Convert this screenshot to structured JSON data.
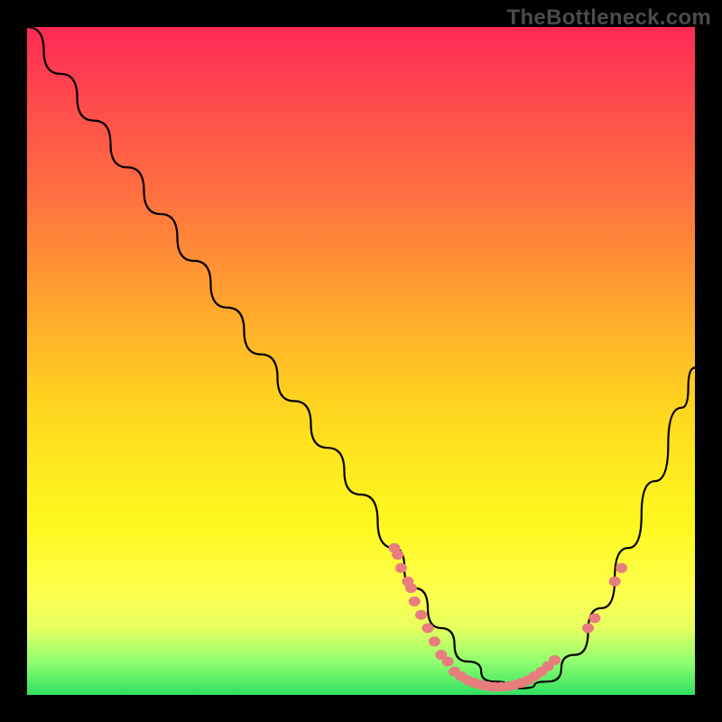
{
  "watermark": "TheBottleneck.com",
  "chart_data": {
    "type": "line",
    "title": "",
    "xlabel": "",
    "ylabel": "",
    "xlim": [
      0,
      100
    ],
    "ylim": [
      0,
      100
    ],
    "curve": {
      "x": [
        0,
        5,
        10,
        15,
        20,
        25,
        30,
        35,
        40,
        45,
        50,
        55,
        58,
        62,
        66,
        70,
        74,
        78,
        82,
        86,
        90,
        94,
        98,
        100
      ],
      "y": [
        100,
        93,
        86,
        79,
        72,
        65,
        58,
        51,
        44,
        37,
        30,
        22,
        16,
        10,
        5,
        2,
        1,
        2,
        6,
        13,
        22,
        32,
        43,
        49
      ]
    },
    "points": [
      {
        "x": 55,
        "y": 22
      },
      {
        "x": 55.5,
        "y": 21
      },
      {
        "x": 56,
        "y": 19
      },
      {
        "x": 57,
        "y": 17
      },
      {
        "x": 57.5,
        "y": 16
      },
      {
        "x": 58,
        "y": 14
      },
      {
        "x": 59,
        "y": 12
      },
      {
        "x": 60,
        "y": 10
      },
      {
        "x": 61,
        "y": 8
      },
      {
        "x": 62,
        "y": 6
      },
      {
        "x": 63,
        "y": 5
      },
      {
        "x": 64,
        "y": 3.5
      },
      {
        "x": 65,
        "y": 2.8
      },
      {
        "x": 66,
        "y": 2.2
      },
      {
        "x": 67,
        "y": 1.8
      },
      {
        "x": 68,
        "y": 1.5
      },
      {
        "x": 69,
        "y": 1.3
      },
      {
        "x": 70,
        "y": 1.2
      },
      {
        "x": 71,
        "y": 1.2
      },
      {
        "x": 72,
        "y": 1.3
      },
      {
        "x": 73,
        "y": 1.5
      },
      {
        "x": 74,
        "y": 1.8
      },
      {
        "x": 75,
        "y": 2.2
      },
      {
        "x": 76,
        "y": 2.8
      },
      {
        "x": 77,
        "y": 3.5
      },
      {
        "x": 78,
        "y": 4.3
      },
      {
        "x": 79,
        "y": 5.2
      },
      {
        "x": 84,
        "y": 10
      },
      {
        "x": 85,
        "y": 11.5
      },
      {
        "x": 88,
        "y": 17
      },
      {
        "x": 89,
        "y": 19
      }
    ]
  }
}
